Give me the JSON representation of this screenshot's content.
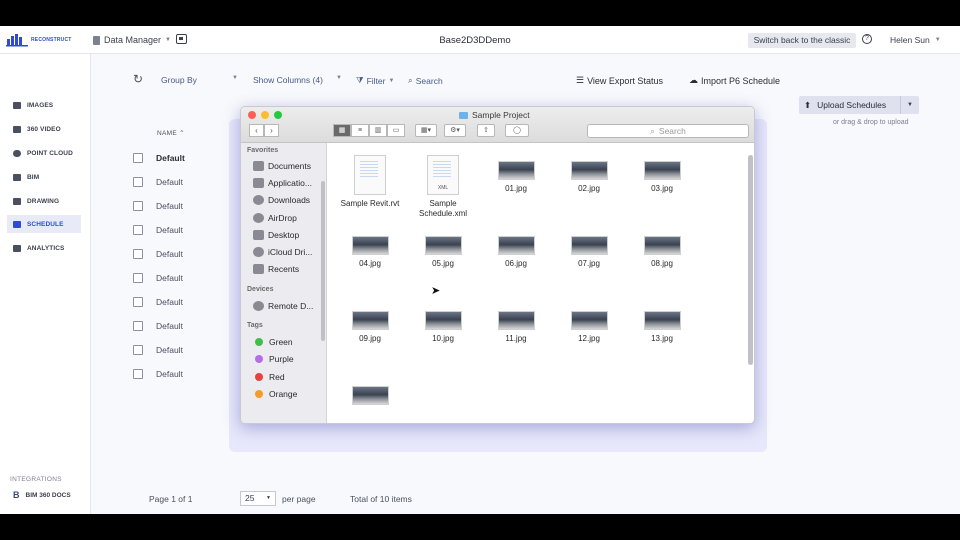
{
  "topbar": {
    "logo_text": "RECONSTRUCT",
    "data_manager": "Data Manager",
    "project_title": "Base2D3DDemo",
    "classic_btn": "Switch back to the classic",
    "user_name": "Helen Sun"
  },
  "sidebar": {
    "items": [
      {
        "label": "IMAGES"
      },
      {
        "label": "360 VIDEO"
      },
      {
        "label": "POINT CLOUD"
      },
      {
        "label": "BIM"
      },
      {
        "label": "DRAWING"
      },
      {
        "label": "SCHEDULE"
      },
      {
        "label": "ANALYTICS"
      }
    ],
    "active": "SCHEDULE",
    "integrations_label": "INTEGRATIONS",
    "bim_docs": "BIM 360 DOCS"
  },
  "toolbar": {
    "group_by": "Group By",
    "show_columns": "Show Columns (4)",
    "filter": "Filter",
    "search": "Search",
    "view_export": "View Export Status",
    "import_p6": "Import P6 Schedule",
    "upload": "Upload Schedules",
    "drag_drop": "or drag & drop to upload"
  },
  "table": {
    "column_name": "NAME",
    "rows": [
      "Default",
      "Default",
      "Default",
      "Default",
      "Default",
      "Default",
      "Default",
      "Default",
      "Default",
      "Default"
    ]
  },
  "pagination": {
    "page_info": "Page 1 of 1",
    "page_size": "25",
    "per_page": "per page",
    "total": "Total of 10 items"
  },
  "finder": {
    "title": "Sample Project",
    "search_placeholder": "Search",
    "favorites_label": "Favorites",
    "favorites": [
      "Documents",
      "Applicatio...",
      "Downloads",
      "AirDrop",
      "Desktop",
      "iCloud Dri...",
      "Recents"
    ],
    "devices_label": "Devices",
    "devices": [
      "Remote D..."
    ],
    "tags_label": "Tags",
    "tags": [
      {
        "name": "Green",
        "color": "#3fbf4a"
      },
      {
        "name": "Purple",
        "color": "#b56ee6"
      },
      {
        "name": "Red",
        "color": "#e8423f"
      },
      {
        "name": "Orange",
        "color": "#f49b2a"
      }
    ],
    "files": [
      {
        "name": "Sample Revit.rvt",
        "kind": "doc",
        "ext": ""
      },
      {
        "name": "Sample Schedule.xml",
        "kind": "doc",
        "ext": "XML"
      },
      {
        "name": "01.jpg",
        "kind": "img"
      },
      {
        "name": "02.jpg",
        "kind": "img"
      },
      {
        "name": "03.jpg",
        "kind": "img"
      },
      {
        "name": "04.jpg",
        "kind": "img"
      },
      {
        "name": "05.jpg",
        "kind": "img"
      },
      {
        "name": "06.jpg",
        "kind": "img"
      },
      {
        "name": "07.jpg",
        "kind": "img"
      },
      {
        "name": "08.jpg",
        "kind": "img"
      },
      {
        "name": "09.jpg",
        "kind": "img"
      },
      {
        "name": "10.jpg",
        "kind": "img"
      },
      {
        "name": "11.jpg",
        "kind": "img"
      },
      {
        "name": "12.jpg",
        "kind": "img"
      },
      {
        "name": "13.jpg",
        "kind": "img"
      },
      {
        "name": "",
        "kind": "img"
      }
    ]
  },
  "colors": {
    "accent": "#2d4bd3",
    "active_bg": "#e8ebf7"
  }
}
